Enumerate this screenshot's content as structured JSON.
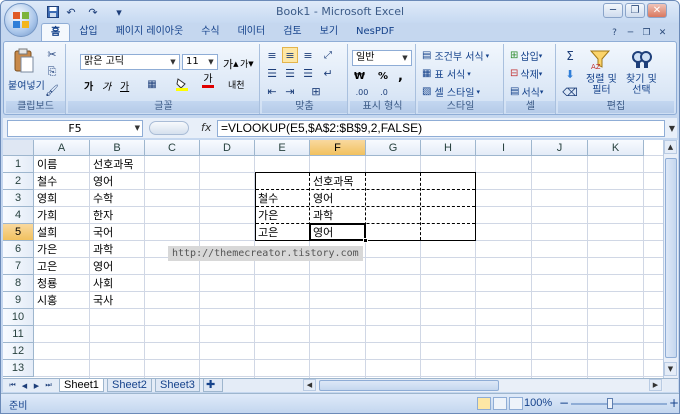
{
  "window": {
    "title": "Book1 - Microsoft Excel",
    "minimize": "─",
    "restore": "❐",
    "close": "✕"
  },
  "quick_access": [
    {
      "name": "save-icon",
      "glyph": "💾"
    },
    {
      "name": "undo-icon",
      "glyph": "↶"
    },
    {
      "name": "redo-icon",
      "glyph": "↷"
    },
    {
      "name": "customize-qat-icon",
      "glyph": "▾"
    }
  ],
  "ribbon_tabs": [
    "홈",
    "삽입",
    "페이지 레이아웃",
    "수식",
    "데이터",
    "검토",
    "보기",
    "NesPDF"
  ],
  "active_tab": "홈",
  "ribbon": {
    "clipboard": {
      "label": "클립보드",
      "paste": "붙여넣기"
    },
    "font": {
      "label": "글꼴",
      "font_name": "맑은 고딕",
      "font_size": "11",
      "grow": "가",
      "shrink": "가",
      "bold": "가",
      "italic": "가",
      "underline": "가",
      "font_color_glyph": "가",
      "phonetic": "내천"
    },
    "alignment": {
      "label": "맞춤"
    },
    "number": {
      "label": "표시 형식",
      "format": "일반",
      "currency": "₩",
      "percent": "%",
      "comma": ","
    },
    "styles": {
      "label": "스타일",
      "conditional": "조건부 서식",
      "table": "표 서식",
      "cell": "셀 스타일"
    },
    "cells": {
      "label": "셀",
      "insert": "삽입",
      "delete": "삭제",
      "format": "서식"
    },
    "editing": {
      "label": "편집",
      "sort_l1": "정렬 및",
      "sort_l2": "필터",
      "find_l1": "찾기 및",
      "find_l2": "선택"
    }
  },
  "formula_bar": {
    "name_box": "F5",
    "fx": "fx",
    "formula": "=VLOOKUP(E5,$A$2:$B$9,2,FALSE)"
  },
  "grid": {
    "columns": [
      "A",
      "B",
      "C",
      "D",
      "E",
      "F",
      "G",
      "H",
      "I",
      "J",
      "K"
    ],
    "rows": [
      "1",
      "2",
      "3",
      "4",
      "5",
      "6",
      "7",
      "8",
      "9",
      "10",
      "11",
      "12",
      "13"
    ],
    "selected_column": "F",
    "selected_row": "5",
    "cells_A": [
      "이름",
      "철수",
      "영희",
      "가희",
      "설희",
      "가은",
      "고은",
      "청룡",
      "시홍"
    ],
    "cells_B": [
      "선호과목",
      "영어",
      "수학",
      "한자",
      "국어",
      "과학",
      "영어",
      "사회",
      "국사"
    ],
    "lookup": {
      "F2": "선호과목",
      "E3": "철수",
      "F3": "영어",
      "E4": "가은",
      "F4": "과학",
      "E5": "고은",
      "F5": "영어"
    },
    "watermark": "http://themecreator.tistory.com"
  },
  "sheets": [
    "Sheet1",
    "Sheet2",
    "Sheet3"
  ],
  "active_sheet": "Sheet1",
  "status": {
    "text": "준비",
    "zoom": "100%",
    "zoom_out": "−",
    "zoom_in": "+"
  }
}
